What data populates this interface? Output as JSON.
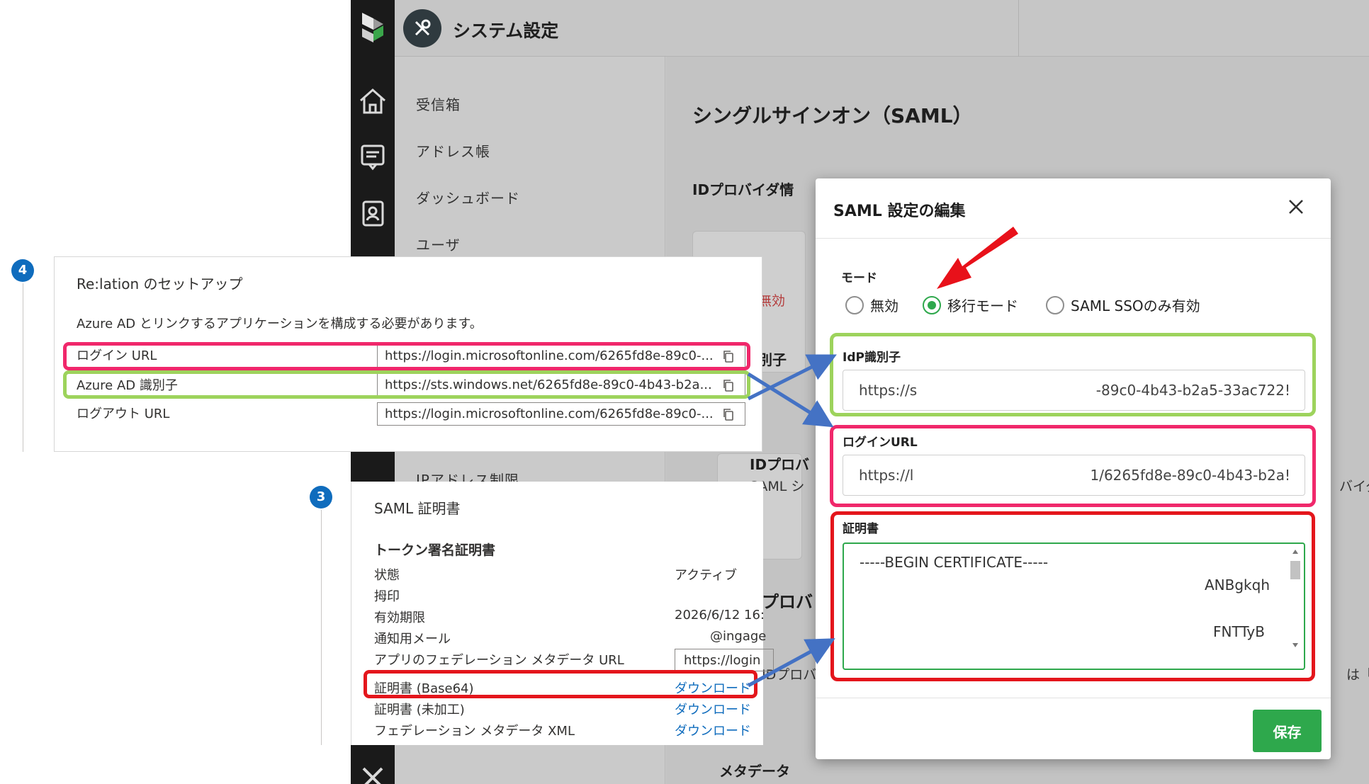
{
  "app": {
    "title": "システム設定",
    "nav": [
      "受信箱",
      "アドレス帳",
      "ダッシュボード",
      "ユーザ"
    ],
    "nav_partial": "IPアドレス制限"
  },
  "main": {
    "title": "シングルサインオン（SAML）",
    "section_idp": "IDプロバイダ情",
    "bg_status": "無効",
    "bg_identifier": "別子",
    "bg_card_title": "IDプロバ",
    "bg_card_sub": "SAML シ",
    "bg_side_right": "バイダ",
    "bg_section2": "プロバ",
    "bg_row": "IDプロバ",
    "bg_right_note": "は「サ",
    "bg_metadata": "メタデータ"
  },
  "modal": {
    "title": "SAML 設定の編集",
    "mode_label": "モード",
    "mode_options": [
      "無効",
      "移行モード",
      "SAML SSOのみ有効"
    ],
    "selected_mode": "移行モード",
    "idp_label": "IdP識別子",
    "idp_value_left": "https://s",
    "idp_value_right": "-89c0-4b43-b2a5-33ac722!",
    "login_label": "ログインURL",
    "login_value_left": "https://l",
    "login_value_right": "1/6265fd8e-89c0-4b43-b2a!",
    "cert_label": "証明書",
    "cert_line1": "-----BEGIN CERTIFICATE-----",
    "cert_line2": "ANBgkqh",
    "cert_line3": "FNTTyB",
    "save_label": "保存"
  },
  "azure_setup": {
    "step": "4",
    "title": "Re:lation のセットアップ",
    "desc": "Azure AD とリンクするアプリケーションを構成する必要があります。",
    "rows": [
      {
        "label": "ログイン URL",
        "value": "https://login.microsoftonline.com/6265fd8e-89c0-..."
      },
      {
        "label": "Azure AD 識別子",
        "value": "https://sts.windows.net/6265fd8e-89c0-4b43-b2a..."
      },
      {
        "label": "ログアウト URL",
        "value": "https://login.microsoftonline.com/6265fd8e-89c0-..."
      }
    ]
  },
  "azure_cert": {
    "step": "3",
    "title": "SAML 証明書",
    "token_title": "トークン署名証明書",
    "rows": [
      {
        "label": "状態",
        "value": "アクティブ"
      },
      {
        "label": "拇印",
        "value": ""
      },
      {
        "label": "有効期限",
        "value": "2026/6/12 16:"
      },
      {
        "label": "通知用メール",
        "value": "@ingage"
      },
      {
        "label": "アプリのフェデレーション メタデータ URL",
        "value": "https://login"
      }
    ],
    "downloads": [
      {
        "label": "証明書 (Base64)",
        "link": "ダウンロード"
      },
      {
        "label": "証明書 (未加工)",
        "link": "ダウンロード"
      },
      {
        "label": "フェデレーション メタデータ XML",
        "link": "ダウンロード"
      }
    ]
  },
  "colors": {
    "green_hl": "#9dd35c",
    "pink_hl": "#f0286b",
    "red_hl": "#e4161c",
    "accent_green": "#2ea84c",
    "arrow_blue": "#4472c4",
    "arrow_red": "#e8111a",
    "azure_blue": "#0f6cbd"
  }
}
